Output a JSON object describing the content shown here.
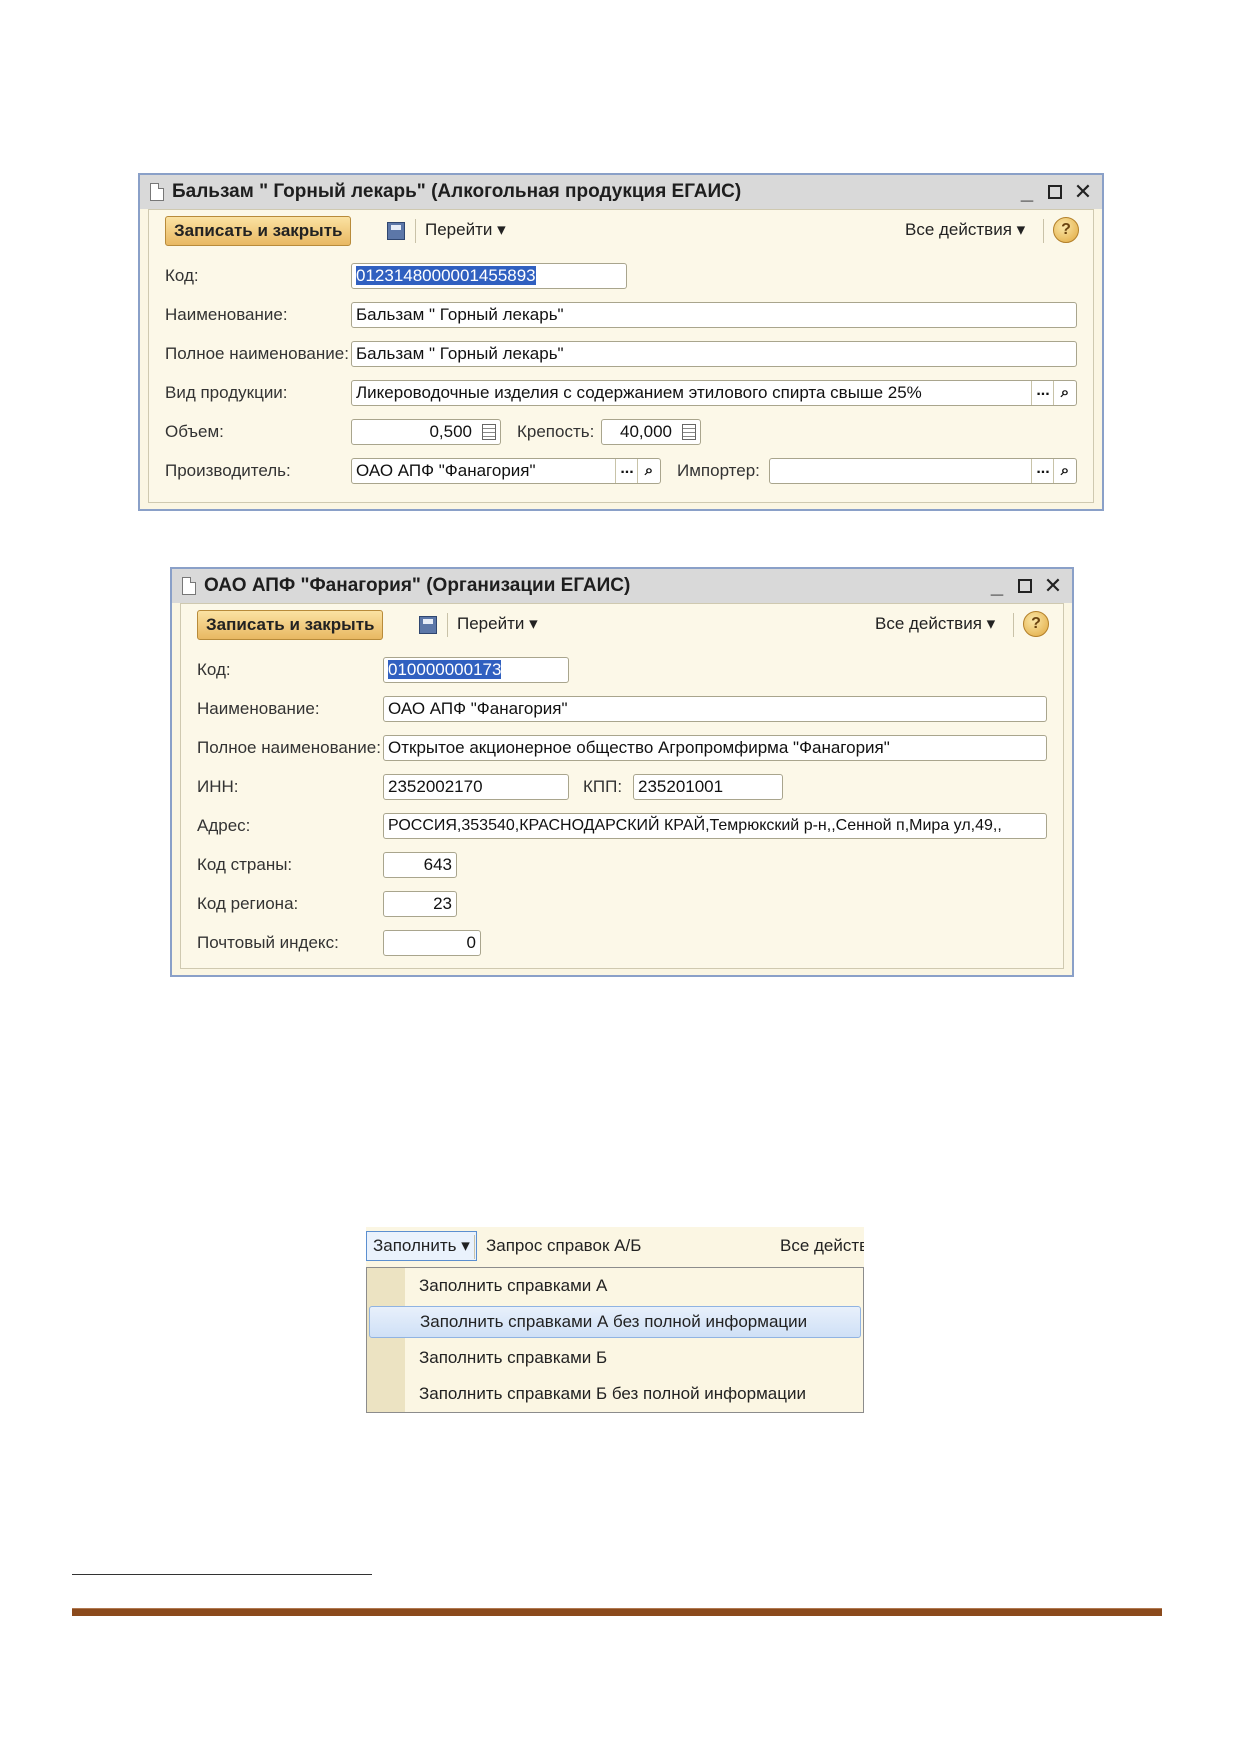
{
  "product_window": {
    "title": "Бальзам \" Горный лекарь\" (Алкогольная продукция ЕГАИС)",
    "toolbar": {
      "save_close": "Записать и закрыть",
      "goto": "Перейти",
      "all_actions": "Все действия",
      "help": "?"
    },
    "fields": {
      "code_label": "Код:",
      "code_value": "0123148000001455893",
      "name_label": "Наименование:",
      "name_value": "Бальзам \" Горный лекарь\"",
      "full_name_label": "Полное наименование:",
      "full_name_value": "Бальзам \" Горный лекарь\"",
      "product_type_label": "Вид продукции:",
      "product_type_value": "Ликероводочные изделия с содержанием этилового спирта свыше 25%",
      "volume_label": "Объем:",
      "volume_value": "0,500",
      "strength_label": "Крепость:",
      "strength_value": "40,000",
      "producer_label": "Производитель:",
      "producer_value": "ОАО АПФ \"Фанагория\"",
      "importer_label": "Импортер:",
      "importer_value": ""
    }
  },
  "org_window": {
    "title": "ОАО АПФ \"Фанагория\" (Организации ЕГАИС)",
    "toolbar": {
      "save_close": "Записать и закрыть",
      "goto": "Перейти",
      "all_actions": "Все действия",
      "help": "?"
    },
    "fields": {
      "code_label": "Код:",
      "code_value": "010000000173",
      "name_label": "Наименование:",
      "name_value": "ОАО АПФ \"Фанагория\"",
      "full_name_label": "Полное наименование:",
      "full_name_value": "Открытое акционерное общество Агропромфирма \"Фанагория\"",
      "inn_label": "ИНН:",
      "inn_value": "2352002170",
      "kpp_label": "КПП:",
      "kpp_value": "235201001",
      "address_label": "Адрес:",
      "address_value": "РОССИЯ,353540,КРАСНОДАРСКИЙ КРАЙ,Темрюкский р-н,,Сенной п,Мира ул,49,,",
      "country_code_label": "Код страны:",
      "country_code_value": "643",
      "region_code_label": "Код региона:",
      "region_code_value": "23",
      "postal_code_label": "Почтовый индекс:",
      "postal_code_value": "0"
    }
  },
  "fill_menu": {
    "button": "Заполнить",
    "request": "Запрос справок А/Б",
    "all_actions": "Все действи",
    "items": [
      "Заполнить справками А",
      "Заполнить справками А без полной информации",
      "Заполнить справками Б",
      "Заполнить справками Б без полной информации"
    ],
    "highlighted_index": 1
  },
  "colors": {
    "form_bg": "#fbf6e3",
    "button_orange": "#e8b862",
    "selection": "#3060c0",
    "rule_brown": "#8b4a1c"
  }
}
